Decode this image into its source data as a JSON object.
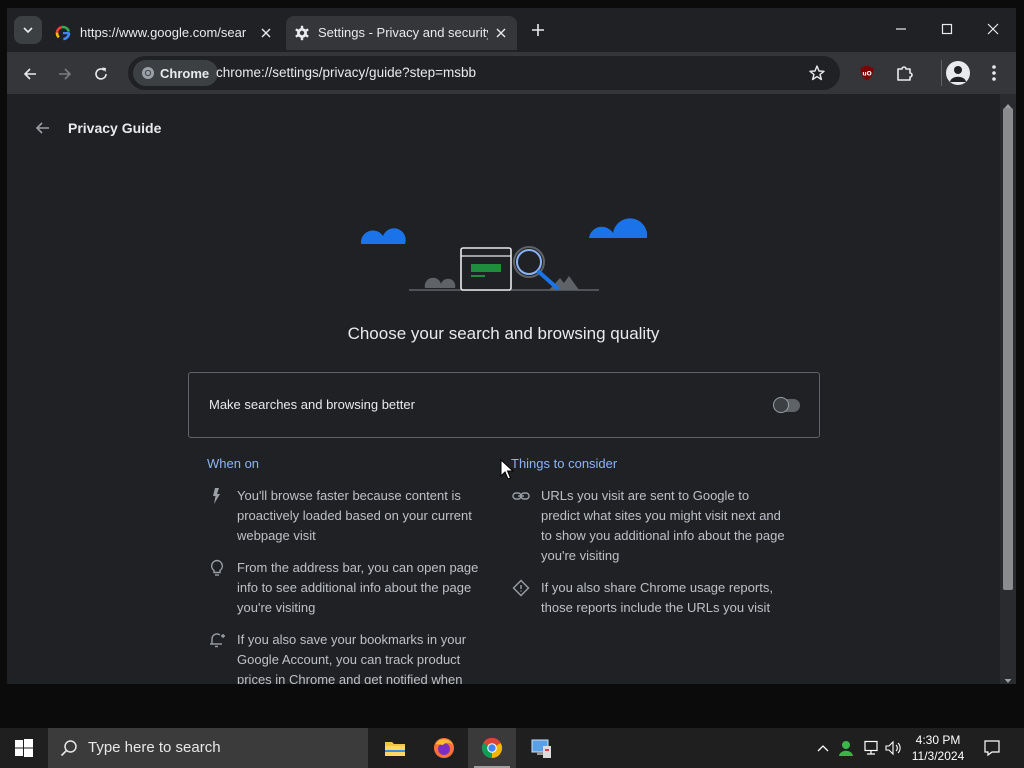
{
  "tabs": [
    {
      "title": "https://www.google.com/search",
      "icon": "google-icon",
      "active": false
    },
    {
      "title": "Settings - Privacy and security",
      "icon": "gear-icon",
      "active": true
    }
  ],
  "toolbar": {
    "chip_label": "Chrome",
    "url": "chrome://settings/privacy/guide?step=msbb"
  },
  "page": {
    "back_label": "Privacy Guide",
    "heading": "Choose your search and browsing quality",
    "toggle_label": "Make searches and browsing better",
    "toggle_on": false,
    "when_on_title": "When on",
    "when_on_items": [
      {
        "icon": "bolt-icon",
        "text": "You'll browse faster because content is proactively loaded based on your current webpage visit"
      },
      {
        "icon": "lightbulb-icon",
        "text": "From the address bar, you can open page info to see additional info about the page you're visiting"
      },
      {
        "icon": "price-alert-icon",
        "text": "If you also save your bookmarks in your Google Account, you can track product prices in Chrome and get notified when"
      }
    ],
    "consider_title": "Things to consider",
    "consider_items": [
      {
        "icon": "link-icon",
        "text": "URLs you visit are sent to Google to predict what sites you might visit next and to show you additional info about the page you're visiting"
      },
      {
        "icon": "diamond-icon",
        "text": "If you also share Chrome usage reports, those reports include the URLs you visit"
      }
    ]
  },
  "taskbar": {
    "search_placeholder": "Type here to search",
    "time": "4:30 PM",
    "date": "11/3/2024"
  },
  "colors": {
    "accent": "#8ab4f8",
    "cloud_blue": "#1a73e8",
    "green": "#1e8e3e",
    "content_bg": "#202124",
    "toolbar_bg": "#35363a"
  }
}
